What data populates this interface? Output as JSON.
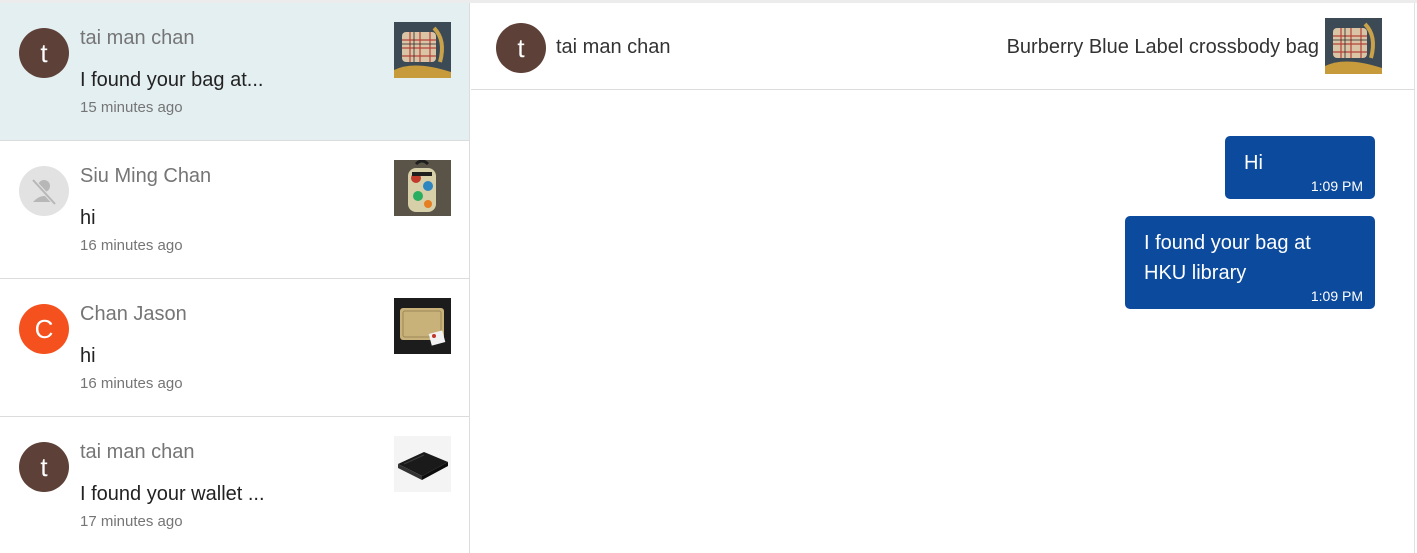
{
  "conversations": [
    {
      "name": "tai man chan",
      "initial": "t",
      "preview": "I found your bag at...",
      "time": "15 minutes ago",
      "avatar_color": "#5d4037",
      "thumbnail_icon": "burberry-bag-thumbnail",
      "active": true
    },
    {
      "name": "Siu Ming Chan",
      "initial": "",
      "preview": "hi",
      "time": "16 minutes ago",
      "avatar_color": "#e2e2e2",
      "thumbnail_icon": "floral-backpack-thumbnail",
      "active": false
    },
    {
      "name": "Chan Jason",
      "initial": "C",
      "preview": "hi",
      "time": "16 minutes ago",
      "avatar_color": "#f4511e",
      "thumbnail_icon": "card-wallet-thumbnail",
      "active": false
    },
    {
      "name": "tai man chan",
      "initial": "t",
      "preview": "I found your wallet ...",
      "time": "17 minutes ago",
      "avatar_color": "#5d4037",
      "thumbnail_icon": "black-wallet-thumbnail",
      "active": false
    }
  ],
  "chat": {
    "header": {
      "name": "tai man chan",
      "initial": "t",
      "item_title": "Burberry Blue Label crossbody bag",
      "thumbnail_icon": "burberry-bag-thumbnail"
    },
    "messages": [
      {
        "text": "Hi",
        "time": "1:09 PM"
      },
      {
        "text": "I found your bag at\nHKU library",
        "time": "1:09 PM"
      }
    ]
  },
  "colors": {
    "active_item_bg": "#e4eff1",
    "bubble_bg": "#0b4a9c",
    "muted_text": "#757575"
  }
}
